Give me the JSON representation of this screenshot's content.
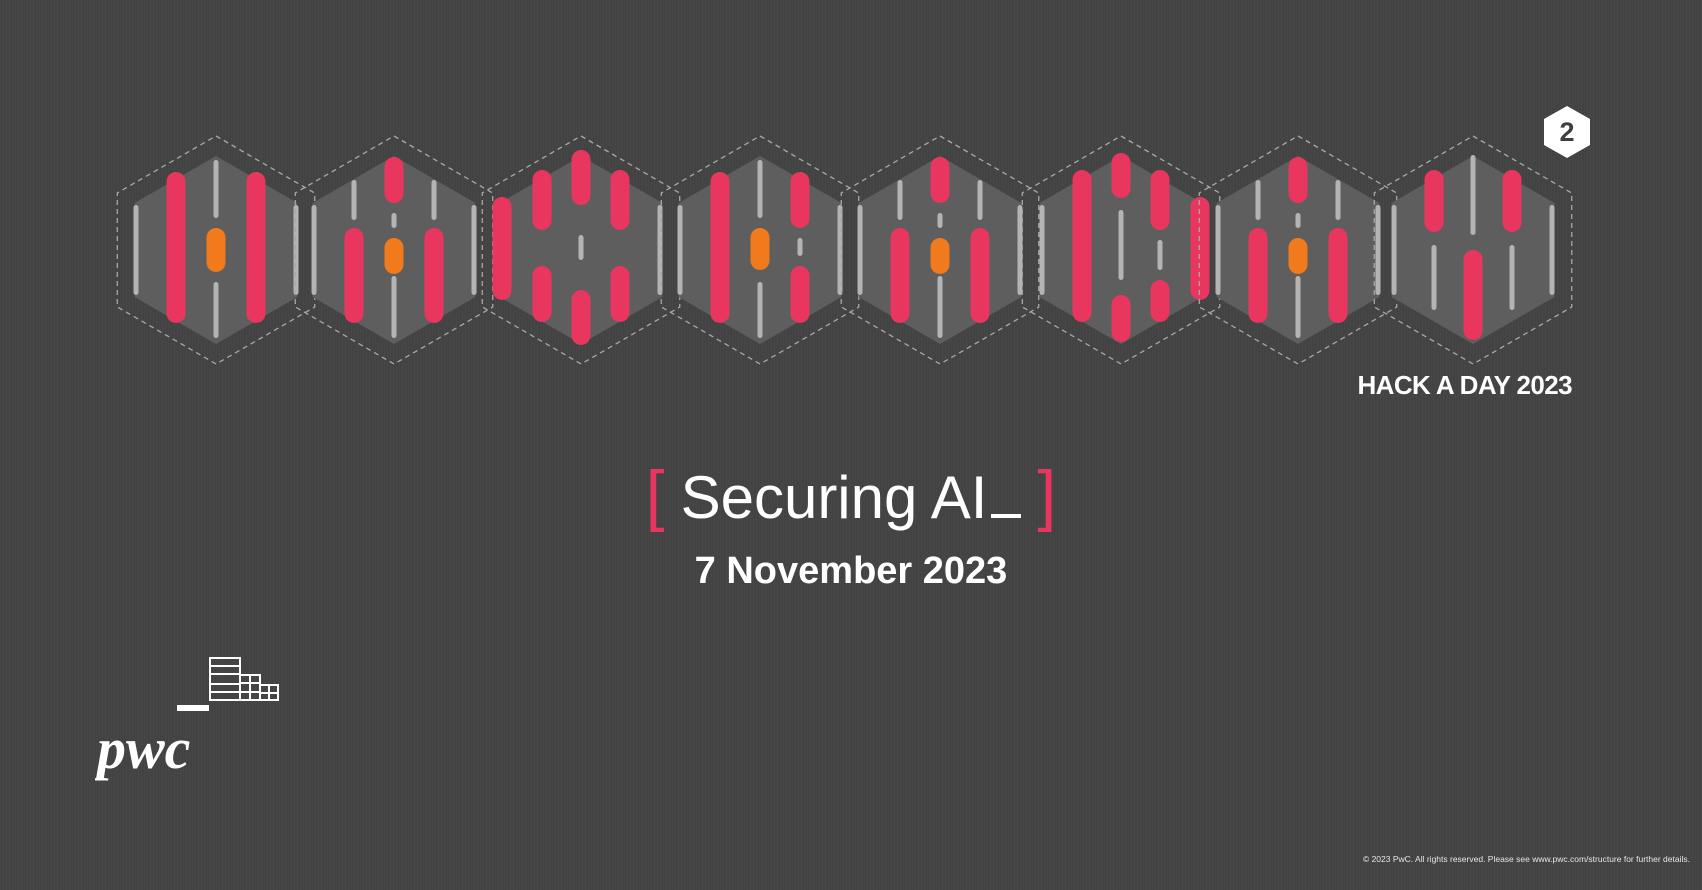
{
  "slide": {
    "badge_number": "2",
    "event_label": "HACK A DAY 2023",
    "title_open_bracket": "[",
    "title": "Securing AI",
    "title_close_bracket": "]",
    "date": "7 November 2023",
    "brand_logo_text": "pwc",
    "footer_note": "© 2023 PwC. All rights reserved. Please see www.pwc.com/structure for further details."
  },
  "colors": {
    "background": "#434343",
    "accent_pink": "#e8365f",
    "accent_orange": "#f07a1c",
    "hex_fill": "#5e5e5e",
    "light_bar": "#b4b4b4",
    "dashed_outline": "#a8a8a8",
    "text": "#ffffff"
  }
}
